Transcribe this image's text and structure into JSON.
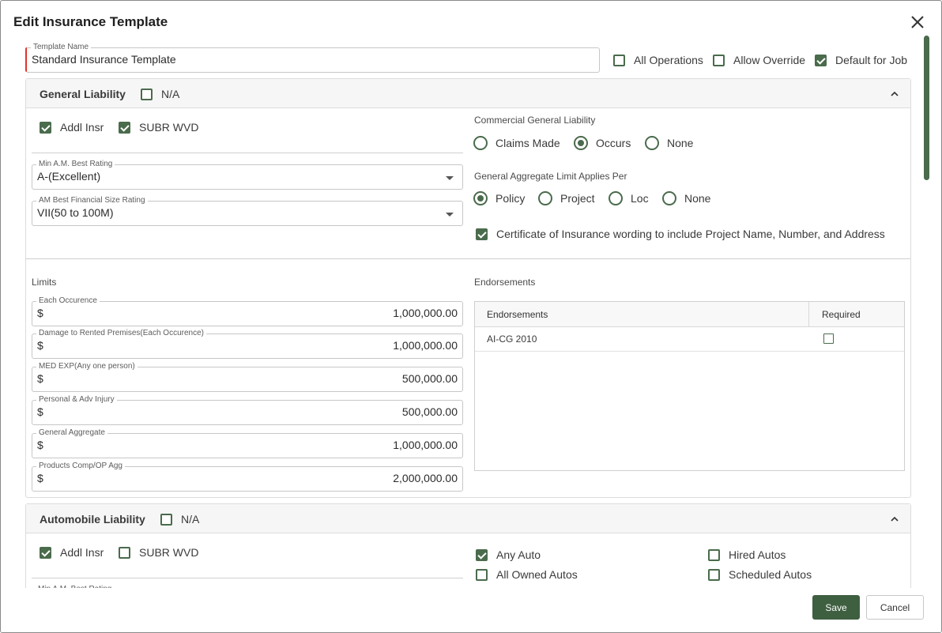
{
  "dialog": {
    "title": "Edit Insurance Template"
  },
  "template": {
    "name_label": "Template Name",
    "name_value": "Standard Insurance Template",
    "all_operations": {
      "label": "All Operations",
      "checked": false
    },
    "allow_override": {
      "label": "Allow Override",
      "checked": false
    },
    "default_for_job": {
      "label": "Default for Job",
      "checked": true
    }
  },
  "general_liability": {
    "title": "General Liability",
    "na_label": "N/A",
    "na_checked": false,
    "addl_insr_label": "Addl Insr",
    "addl_insr_checked": true,
    "subr_wvd_label": "SUBR WVD",
    "subr_wvd_checked": true,
    "min_am_best": {
      "label": "Min A.M. Best Rating",
      "value": "A-(Excellent)"
    },
    "am_best_size": {
      "label": "AM Best Financial Size Rating",
      "value": "VII(50 to 100M)"
    },
    "cgl": {
      "label": "Commercial General Liability",
      "options": [
        "Claims Made",
        "Occurs",
        "None"
      ],
      "selected": "Occurs"
    },
    "aggregate_per": {
      "label": "General Aggregate Limit Applies Per",
      "options": [
        "Policy",
        "Project",
        "Loc",
        "None"
      ],
      "selected": "Policy"
    },
    "coi_wording": {
      "label": "Certificate of Insurance wording to include Project Name, Number, and Address",
      "checked": true
    },
    "limits_label": "Limits",
    "limits": [
      {
        "label": "Each Occurence",
        "currency": "$",
        "amount": "1,000,000.00"
      },
      {
        "label": "Damage to Rented Premises(Each Occurence)",
        "currency": "$",
        "amount": "1,000,000.00"
      },
      {
        "label": "MED EXP(Any one person)",
        "currency": "$",
        "amount": "500,000.00"
      },
      {
        "label": "Personal & Adv Injury",
        "currency": "$",
        "amount": "500,000.00"
      },
      {
        "label": "General Aggregate",
        "currency": "$",
        "amount": "1,000,000.00"
      },
      {
        "label": "Products Comp/OP Agg",
        "currency": "$",
        "amount": "2,000,000.00"
      }
    ],
    "endorsements_label": "Endorsements",
    "endorsements_table": {
      "columns": [
        "Endorsements",
        "Required"
      ],
      "rows": [
        {
          "name": "AI-CG 2010",
          "required": false
        }
      ]
    }
  },
  "automobile_liability": {
    "title": "Automobile Liability",
    "na_label": "N/A",
    "na_checked": false,
    "addl_insr_label": "Addl Insr",
    "addl_insr_checked": true,
    "subr_wvd_label": "SUBR WVD",
    "subr_wvd_checked": false,
    "any_auto": {
      "label": "Any Auto",
      "checked": true
    },
    "all_owned_autos": {
      "label": "All Owned Autos",
      "checked": false
    },
    "hired_autos": {
      "label": "Hired Autos",
      "checked": false
    },
    "scheduled_autos": {
      "label": "Scheduled Autos",
      "checked": false
    },
    "min_am_best_partial_label": "Min A.M. Best Rating"
  },
  "footer": {
    "save_label": "Save",
    "cancel_label": "Cancel"
  },
  "colors": {
    "accent": "#4a6b4c",
    "required_marker": "#e0342b",
    "save_button": "#3f5f41"
  }
}
